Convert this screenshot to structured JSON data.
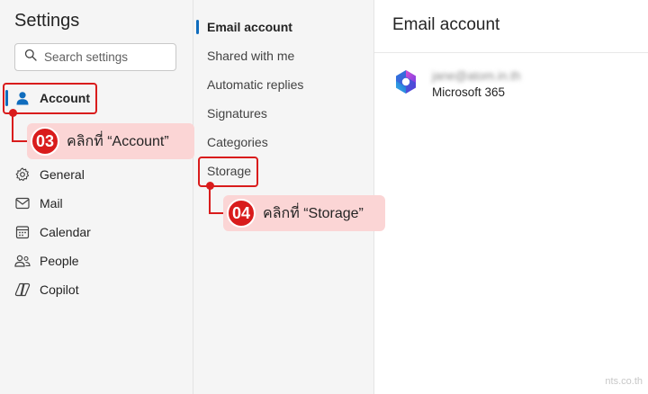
{
  "settings": {
    "title": "Settings",
    "search_placeholder": "Search settings",
    "nav": [
      {
        "label": "Account",
        "icon": "person-icon",
        "selected": true
      },
      {
        "label": "General",
        "icon": "gear-icon"
      },
      {
        "label": "Mail",
        "icon": "mail-icon"
      },
      {
        "label": "Calendar",
        "icon": "calendar-icon"
      },
      {
        "label": "People",
        "icon": "people-icon"
      },
      {
        "label": "Copilot",
        "icon": "copilot-icon"
      }
    ]
  },
  "account_menu": {
    "items": [
      {
        "label": "Email account",
        "active": true
      },
      {
        "label": "Shared with me"
      },
      {
        "label": "Automatic replies"
      },
      {
        "label": "Signatures"
      },
      {
        "label": "Categories"
      },
      {
        "label": "Storage"
      }
    ]
  },
  "detail": {
    "title": "Email account",
    "email": "jane@atom.in.th",
    "account_type": "Microsoft 365"
  },
  "annotations": {
    "step3": {
      "number": "03",
      "text": "คลิกที่ “Account”"
    },
    "step4": {
      "number": "04",
      "text": "คลิกที่ “Storage”"
    }
  },
  "watermark": "nts.co.th",
  "colors": {
    "accent": "#0f6cbd",
    "annotation_red": "#d91c1c",
    "callout_bg": "#fbd5d5"
  }
}
